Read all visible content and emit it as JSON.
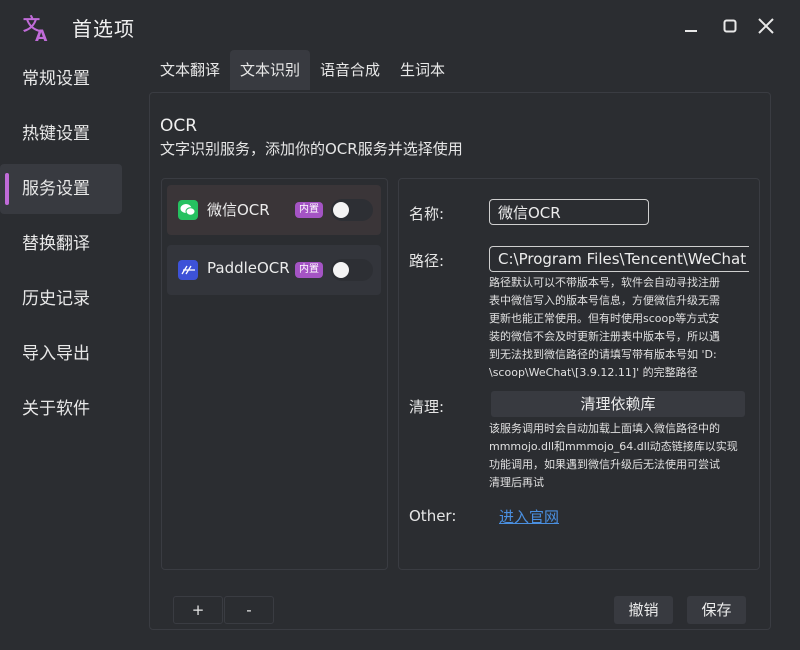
{
  "window": {
    "title": "首选项",
    "accent": "#c06bd8"
  },
  "sidebar": {
    "items": [
      {
        "label": "常规设置"
      },
      {
        "label": "热键设置"
      },
      {
        "label": "服务设置",
        "active": true
      },
      {
        "label": "替换翻译"
      },
      {
        "label": "历史记录"
      },
      {
        "label": "导入导出"
      },
      {
        "label": "关于软件"
      }
    ]
  },
  "tabs": [
    {
      "label": "文本翻译"
    },
    {
      "label": "文本识别",
      "active": true
    },
    {
      "label": "语音合成"
    },
    {
      "label": "生词本"
    }
  ],
  "section": {
    "title": "OCR",
    "description": "文字识别服务，添加你的OCR服务并选择使用"
  },
  "services": [
    {
      "name": "微信OCR",
      "badge": "内置",
      "icon": "wechat-icon",
      "enabled": false,
      "selected": true
    },
    {
      "name": "PaddleOCR",
      "badge": "内置",
      "icon": "paddle-icon",
      "enabled": false,
      "selected": false
    }
  ],
  "detail": {
    "name_label": "名称:",
    "name_value": "微信OCR",
    "path_label": "路径:",
    "path_value": "C:\\Program Files\\Tencent\\WeChat",
    "path_help": [
      "路径默认可以不带版本号，软件会自动寻找注册",
      "表中微信写入的版本号信息，方便微信升级无需",
      "更新也能正常使用。但有时使用scoop等方式安",
      "装的微信不会及时更新注册表中版本号，所以遇",
      "到无法找到微信路径的请填写带有版本号如 'D:",
      "\\scoop\\WeChat\\[3.9.12.11]' 的完整路径"
    ],
    "clean_label": "清理:",
    "clean_button": "清理依赖库",
    "clean_help": [
      "该服务调用时会自动加载上面填入微信路径中的",
      "mmmojo.dll和mmmojo_64.dll动态链接库以实现",
      "功能调用，如果遇到微信升级后无法使用可尝试",
      "清理后再试"
    ],
    "other_label": "Other:",
    "other_link": "进入官网"
  },
  "footer": {
    "add": "+",
    "remove": "-",
    "cancel": "撤销",
    "save": "保存"
  }
}
